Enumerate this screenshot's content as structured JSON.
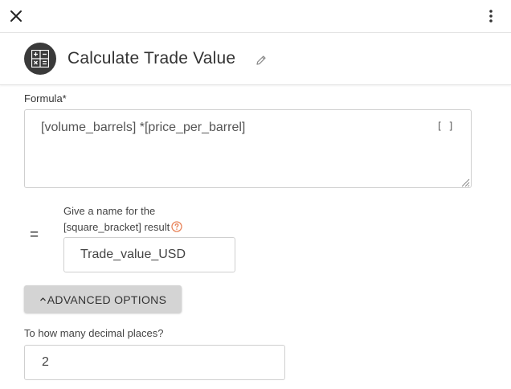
{
  "topbar": {
    "close_icon": "close-icon",
    "menu_icon": "kebab-menu-icon"
  },
  "header": {
    "avatar_icon": "calculator-icon",
    "title": "Calculate Trade Value",
    "edit_icon": "pencil-icon"
  },
  "formula": {
    "label": "Formula*",
    "value": "[volume_barrels] *[price_per_barrel]",
    "bracket_button": "[ ]"
  },
  "result": {
    "equals": "=",
    "label_line1": "Give a name for the",
    "label_line2": "[square_bracket] result",
    "help_icon": "question-circle-icon",
    "value": "Trade_value_USD"
  },
  "advanced": {
    "label": "ADVANCED OPTIONS",
    "icon": "chevron-up-icon"
  },
  "decimal": {
    "label": "To how many decimal places?",
    "value": "2"
  },
  "colors": {
    "avatar_bg": "#3a3a3a",
    "help_accent": "#e8845a",
    "button_bg": "#d4d4d4"
  }
}
